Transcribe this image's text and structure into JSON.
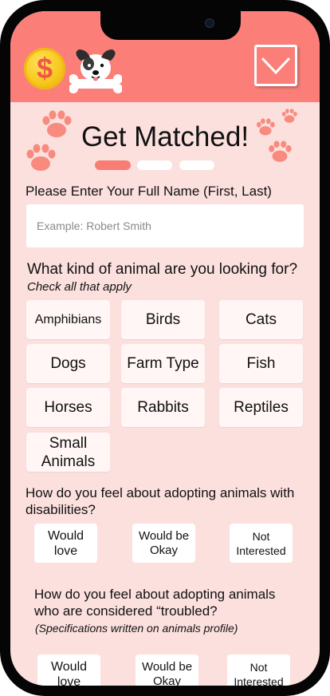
{
  "header": {
    "coin_symbol": "$",
    "accent_color": "#fb7f78",
    "icons": [
      "dollar-coin-icon",
      "dog-logo-icon",
      "chevron-down-icon"
    ]
  },
  "page": {
    "title": "Get Matched!",
    "progress": {
      "current_step": 1,
      "total_steps": 3
    }
  },
  "name_field": {
    "label": "Please Enter Your Full Name (First, Last)",
    "placeholder": "Example: Robert Smith"
  },
  "animal_question": {
    "label": "What kind of animal are you looking for?",
    "hint": "Check all that apply",
    "options": [
      "Amphibians",
      "Birds",
      "Cats",
      "Dogs",
      "Farm Type",
      "Fish",
      "Horses",
      "Rabbits",
      "Reptiles",
      "Small\nAnimals"
    ]
  },
  "disability_question": {
    "label": "How do you feel about adopting animals with disabilities?",
    "options": [
      "Would\nlove",
      "Would be\nOkay",
      "Not\nInterested"
    ]
  },
  "troubled_question": {
    "label": "How do you feel about adopting animals who are considered “troubled?",
    "hint": "(Specifications written on animals profile)",
    "options": [
      "Would\nlove",
      "Would be\nOkay",
      "Not\nInterested"
    ]
  }
}
